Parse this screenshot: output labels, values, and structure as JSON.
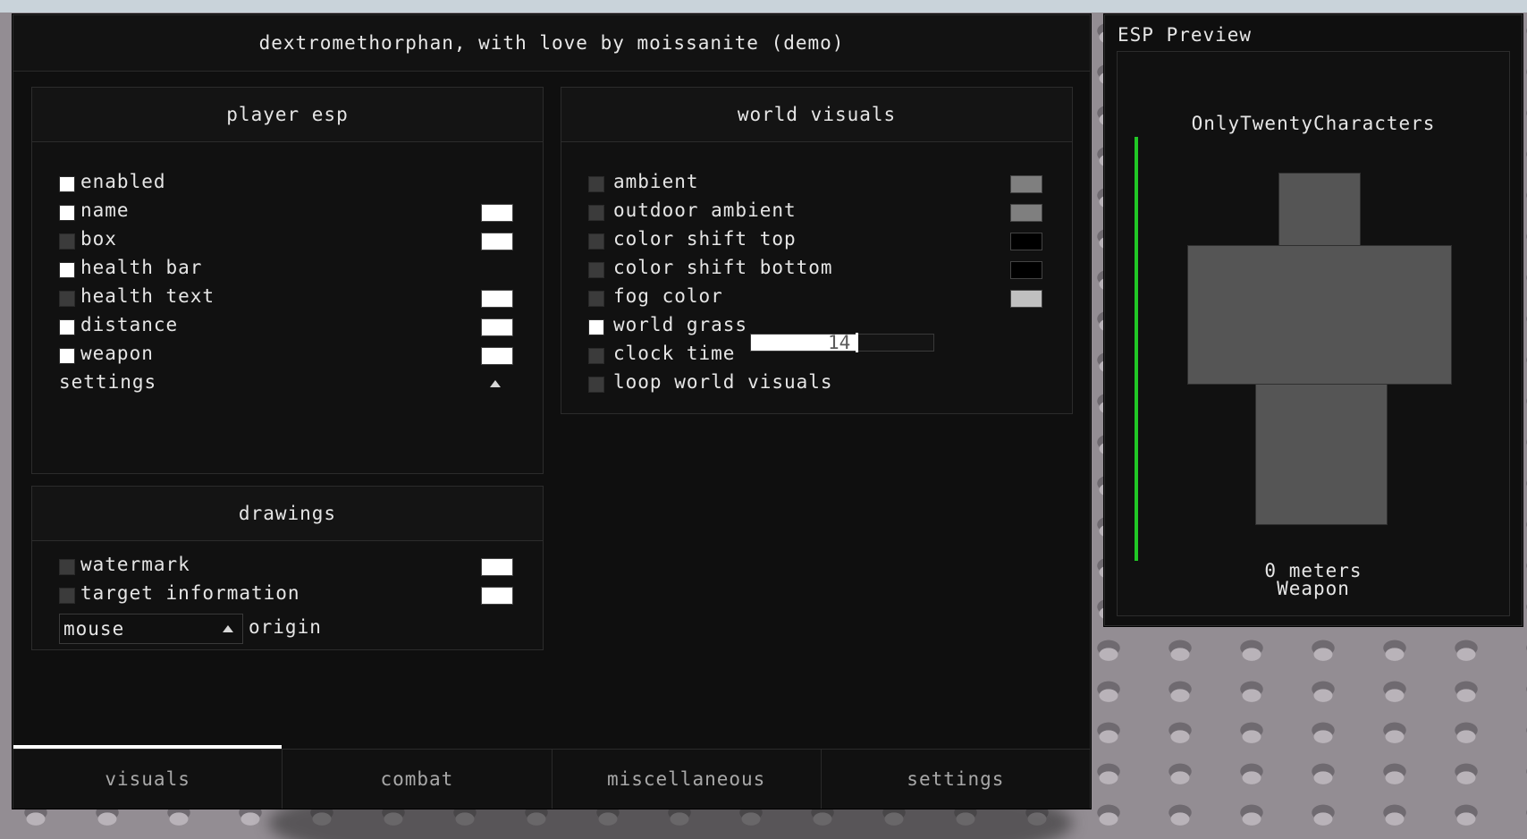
{
  "window": {
    "title": "dextromethorphan, with love by moissanite (demo)"
  },
  "player_esp": {
    "title": "player esp",
    "items": [
      {
        "label": "enabled",
        "checked": true,
        "color": null
      },
      {
        "label": "name",
        "checked": true,
        "color": "#ffffff"
      },
      {
        "label": "box",
        "checked": false,
        "color": "#ffffff"
      },
      {
        "label": "health bar",
        "checked": true,
        "color": null
      },
      {
        "label": "health text",
        "checked": false,
        "color": "#ffffff"
      },
      {
        "label": "distance",
        "checked": true,
        "color": "#ffffff"
      },
      {
        "label": "weapon",
        "checked": true,
        "color": "#ffffff"
      }
    ],
    "settings_label": "settings"
  },
  "drawings": {
    "title": "drawings",
    "items": [
      {
        "label": "watermark",
        "checked": false,
        "color": "#ffffff"
      },
      {
        "label": "target information",
        "checked": false,
        "color": "#ffffff"
      }
    ],
    "origin_select": {
      "value": "mouse",
      "label": "origin"
    }
  },
  "world_visuals": {
    "title": "world visuals",
    "items": [
      {
        "label": "ambient",
        "checked": false,
        "color": "#7f7f7f"
      },
      {
        "label": "outdoor ambient",
        "checked": false,
        "color": "#7f7f7f"
      },
      {
        "label": "color shift top",
        "checked": false,
        "color": "#000000"
      },
      {
        "label": "color shift bottom",
        "checked": false,
        "color": "#000000"
      },
      {
        "label": "fog color",
        "checked": false,
        "color": "#c0c0c0"
      },
      {
        "label": "world grass",
        "checked": true,
        "color": null
      },
      {
        "label": "clock time",
        "checked": false,
        "color": null
      },
      {
        "label": "loop world visuals",
        "checked": false,
        "color": null
      }
    ],
    "clock_time": {
      "value": "14",
      "fraction": 0.58
    }
  },
  "tabs": [
    {
      "label": "visuals",
      "active": true
    },
    {
      "label": "combat",
      "active": false
    },
    {
      "label": "miscellaneous",
      "active": false
    },
    {
      "label": "settings",
      "active": false
    }
  ],
  "esp_preview": {
    "title": "ESP Preview",
    "name": "OnlyTwentyCharacters",
    "distance": "0 meters",
    "weapon": "Weapon",
    "health_color": "#21c826"
  }
}
